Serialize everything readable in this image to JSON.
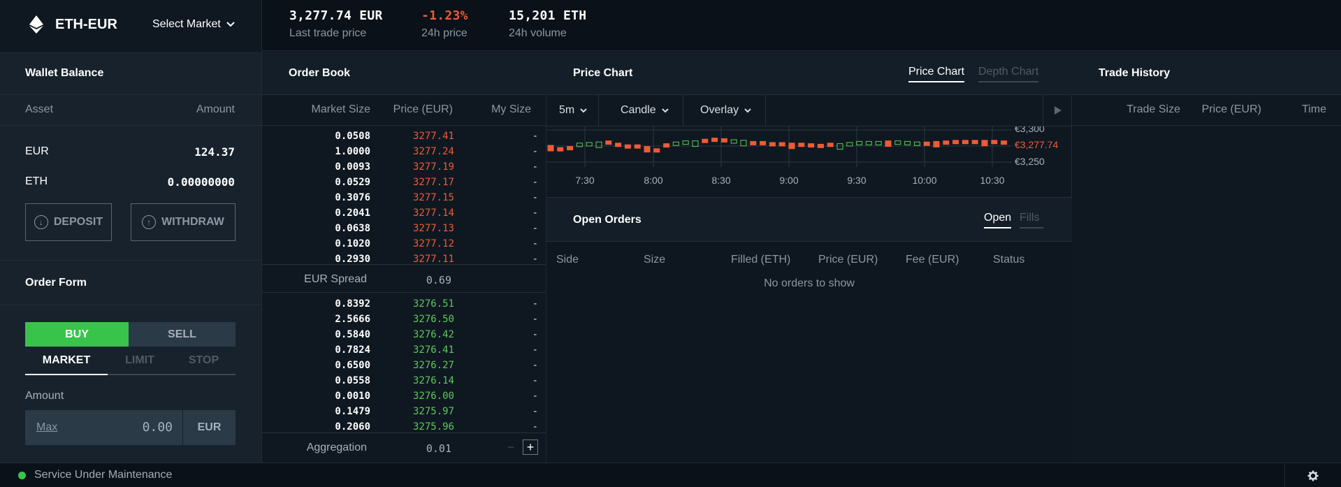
{
  "header": {
    "pair": "ETH-EUR",
    "select_market": "Select Market",
    "last_price": "3,277.74 EUR",
    "last_price_label": "Last trade price",
    "change": "-1.23%",
    "change_label": "24h price",
    "volume": "15,201 ETH",
    "volume_label": "24h volume"
  },
  "wallet": {
    "title": "Wallet Balance",
    "col_asset": "Asset",
    "col_amount": "Amount",
    "rows": [
      {
        "asset": "EUR",
        "amount": "124.37"
      },
      {
        "asset": "ETH",
        "amount": "0.00000000"
      }
    ],
    "deposit": "DEPOSIT",
    "withdraw": "WITHDRAW"
  },
  "order_form": {
    "title": "Order Form",
    "buy": "BUY",
    "sell": "SELL",
    "tabs": [
      "MARKET",
      "LIMIT",
      "STOP"
    ],
    "amount_label": "Amount",
    "max": "Max",
    "amount_value": "0.00",
    "currency": "EUR"
  },
  "order_book": {
    "title": "Order Book",
    "col_market_size": "Market Size",
    "col_price": "Price (EUR)",
    "col_my_size": "My Size",
    "asks": [
      {
        "size": "0.0508",
        "price": "3277.41"
      },
      {
        "size": "1.0000",
        "price": "3277.24"
      },
      {
        "size": "0.0093",
        "price": "3277.19"
      },
      {
        "size": "0.0529",
        "price": "3277.17"
      },
      {
        "size": "0.3076",
        "price": "3277.15"
      },
      {
        "size": "0.2041",
        "price": "3277.14"
      },
      {
        "size": "0.0638",
        "price": "3277.13"
      },
      {
        "size": "0.1020",
        "price": "3277.12"
      },
      {
        "size": "0.2930",
        "price": "3277.11"
      }
    ],
    "spread_label": "EUR Spread",
    "spread_value": "0.69",
    "bids": [
      {
        "size": "0.8392",
        "price": "3276.51"
      },
      {
        "size": "2.5666",
        "price": "3276.50"
      },
      {
        "size": "0.5840",
        "price": "3276.42"
      },
      {
        "size": "0.7824",
        "price": "3276.41"
      },
      {
        "size": "0.6500",
        "price": "3276.27"
      },
      {
        "size": "0.0558",
        "price": "3276.14"
      },
      {
        "size": "0.0010",
        "price": "3276.00"
      },
      {
        "size": "0.1479",
        "price": "3275.97"
      },
      {
        "size": "0.2060",
        "price": "3275.96"
      }
    ],
    "my_size": "-",
    "aggregation_label": "Aggregation",
    "aggregation_value": "0.01"
  },
  "price_chart": {
    "title": "Price Chart",
    "tab_price": "Price Chart",
    "tab_depth": "Depth Chart",
    "interval": "5m",
    "style": "Candle",
    "overlay": "Overlay",
    "y_ticks": [
      "€3,300",
      "€3,250"
    ],
    "current_label": "€3,277.74",
    "x_ticks": [
      "7:30",
      "8:00",
      "8:30",
      "9:00",
      "9:30",
      "10:00",
      "10:30"
    ]
  },
  "open_orders": {
    "title": "Open Orders",
    "tab_open": "Open",
    "tab_fills": "Fills",
    "cols": [
      "Side",
      "Size",
      "Filled (ETH)",
      "Price (EUR)",
      "Fee (EUR)",
      "Status"
    ],
    "empty": "No orders to show"
  },
  "trade_history": {
    "title": "Trade History",
    "col_size": "Trade Size",
    "col_price": "Price (EUR)",
    "col_time": "Time"
  },
  "footer": {
    "status": "Service Under Maintenance"
  },
  "colors": {
    "accent_green": "#38c44b",
    "accent_red": "#f05a35",
    "background": "#0e1620"
  }
}
